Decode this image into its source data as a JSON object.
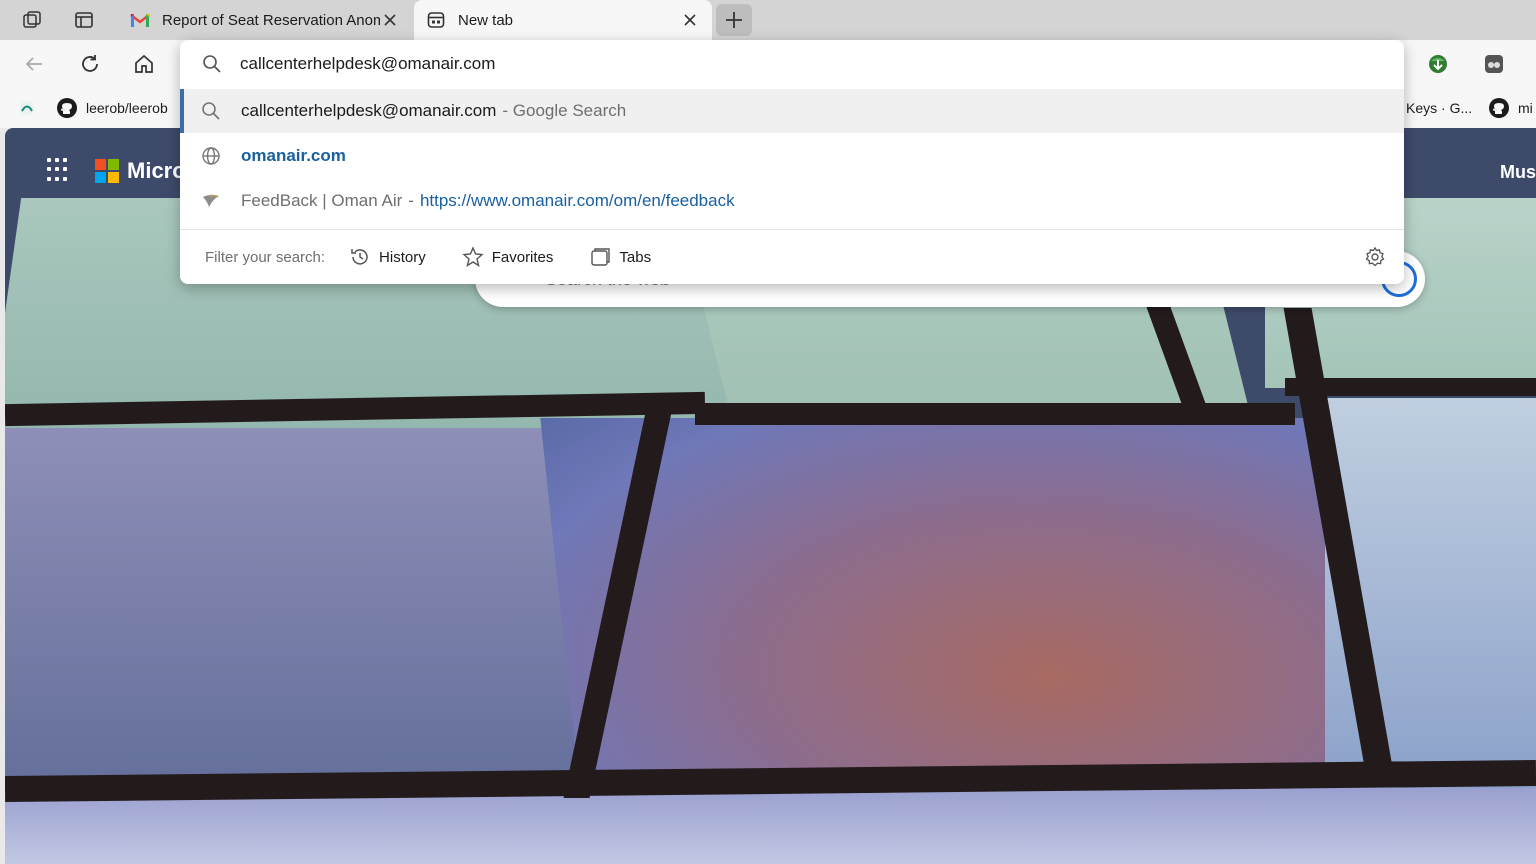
{
  "tabs": [
    {
      "title": "Report of Seat Reservation Anom",
      "favicon": "gmail-icon",
      "active": false
    },
    {
      "title": "New tab",
      "favicon": "new-tab-page-icon",
      "active": true
    }
  ],
  "omnibox": {
    "value": "callcenterhelpdesk@omanair.com",
    "suggestions": [
      {
        "text": "callcenterhelpdesk@omanair.com",
        "suffix": "- Google Search",
        "icon": "search-icon"
      },
      {
        "text": "omanair.com",
        "icon": "globe-icon"
      },
      {
        "title": "FeedBack | Oman Air",
        "separator": "-",
        "url": "https://www.omanair.com/om/en/feedback",
        "icon": "oman-air-favicon"
      }
    ],
    "filter_label": "Filter your search:",
    "filters": [
      "History",
      "Favorites",
      "Tabs"
    ]
  },
  "favorites": [
    {
      "label": "leerob/leerob",
      "icon": "github-icon"
    },
    {
      "label": "Keys · G...",
      "icon": ""
    },
    {
      "label": "mi",
      "icon": "github-icon"
    }
  ],
  "page": {
    "brand": "Micro",
    "right_label": "Mus",
    "search_placeholder": "Search the web"
  },
  "colors": {
    "accent": "#3a6ea5",
    "link": "#1a5fa0",
    "ms_red": "#f25022",
    "ms_green": "#7fba00",
    "ms_blue": "#00a4ef",
    "ms_yellow": "#ffb900"
  }
}
